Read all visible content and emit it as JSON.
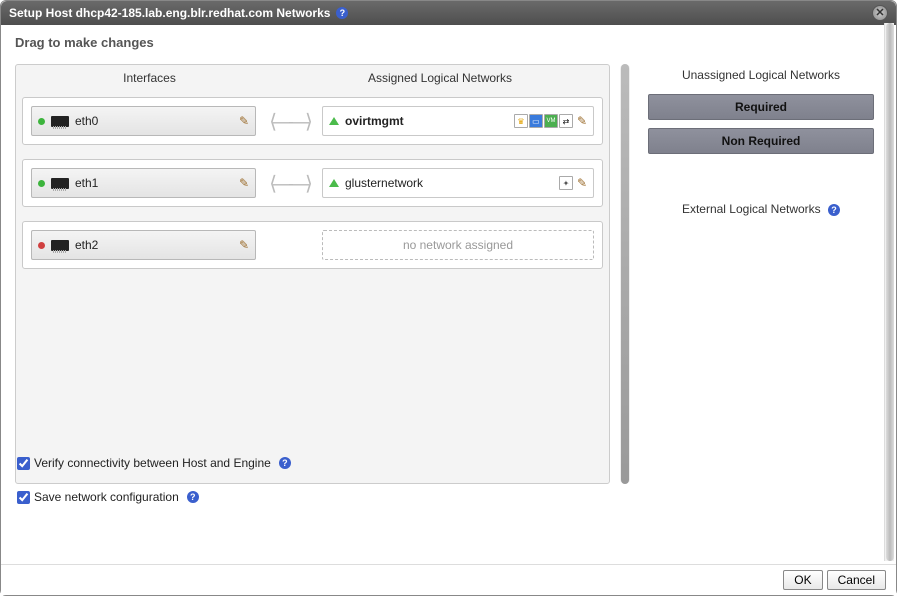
{
  "title": "Setup Host dhcp42-185.lab.eng.blr.redhat.com Networks",
  "drag_hint": "Drag to make changes",
  "columns": {
    "interfaces_header": "Interfaces",
    "assigned_header": "Assigned Logical Networks"
  },
  "interfaces": [
    {
      "name": "eth0",
      "status": "up",
      "assigned": {
        "name": "ovirtmgmt",
        "bold": true,
        "badges": [
          "crown",
          "display",
          "vm",
          "migration"
        ],
        "editable": true
      }
    },
    {
      "name": "eth1",
      "status": "up",
      "assigned": {
        "name": "glusternetwork",
        "bold": false,
        "badges": [
          "wrench"
        ],
        "editable": true
      }
    },
    {
      "name": "eth2",
      "status": "down",
      "assigned": null
    }
  ],
  "no_network_text": "no network assigned",
  "unassigned": {
    "header": "Unassigned Logical Networks",
    "required_label": "Required",
    "non_required_label": "Non Required",
    "external_header": "External Logical Networks"
  },
  "checks": {
    "verify_label": "Verify connectivity between Host and Engine",
    "verify_checked": true,
    "save_label": "Save network configuration",
    "save_checked": true
  },
  "buttons": {
    "ok": "OK",
    "cancel": "Cancel"
  }
}
